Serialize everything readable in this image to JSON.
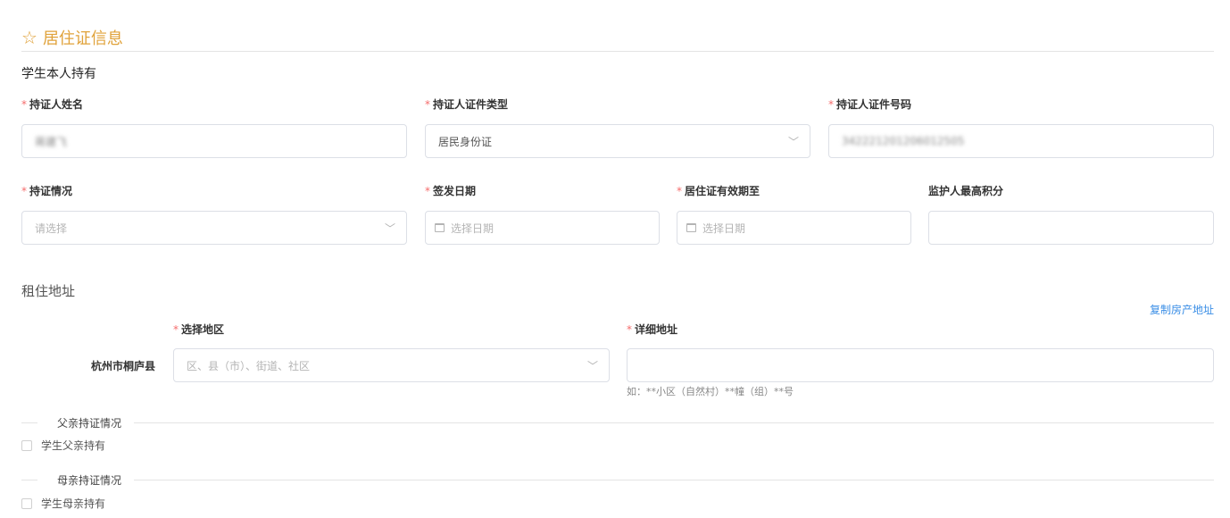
{
  "section": {
    "icon": "star-outline-icon",
    "title": "居住证信息"
  },
  "holder": {
    "subtitle": "学生本人持有"
  },
  "fields": {
    "name": {
      "label": "持证人姓名",
      "value": "蒋建飞",
      "required": true
    },
    "id_type": {
      "label": "持证人证件类型",
      "value": "居民身份证",
      "required": true
    },
    "id_number": {
      "label": "持证人证件号码",
      "value": "342221201206012505",
      "required": true
    },
    "status": {
      "label": "持证情况",
      "placeholder": "请选择",
      "required": true
    },
    "issue_date": {
      "label": "签发日期",
      "placeholder": "选择日期",
      "required": true
    },
    "valid_until": {
      "label": "居住证有效期至",
      "placeholder": "选择日期",
      "required": true
    },
    "guardian_score": {
      "label": "监护人最高积分",
      "value": "",
      "required": false
    }
  },
  "rental": {
    "title": "租住地址",
    "copy_link": "复制房产地址",
    "region": {
      "label": "选择地区",
      "prefix": "杭州市桐庐县",
      "placeholder": "区、县（市）、街道、社区",
      "required": true
    },
    "address": {
      "label": "详细地址",
      "value": "",
      "hint": "如：**小区（自然村）**幢（组）**号",
      "required": true
    }
  },
  "father": {
    "divider": "父亲持证情况",
    "checkbox": "学生父亲持有",
    "checked": false
  },
  "mother": {
    "divider": "母亲持证情况",
    "checkbox": "学生母亲持有",
    "checked": false
  },
  "colors": {
    "accent": "#e0a23a",
    "required": "#f56c6c",
    "link": "#3a8ee6",
    "border": "#dcdfe6"
  }
}
